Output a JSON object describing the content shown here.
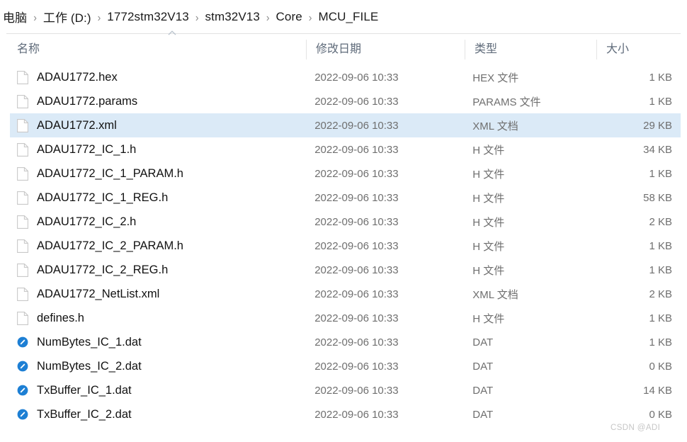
{
  "breadcrumb": {
    "separator": "›",
    "items": [
      {
        "label": "电脑"
      },
      {
        "label": "工作 (D:)"
      },
      {
        "label": "1772stm32V13"
      },
      {
        "label": "stm32V13"
      },
      {
        "label": "Core"
      },
      {
        "label": "MCU_FILE"
      }
    ]
  },
  "columns": {
    "name": "名称",
    "date": "修改日期",
    "type": "类型",
    "size": "大小",
    "sort_indicator": "ascending-caret-icon"
  },
  "colors": {
    "selection": "#dbeaf7",
    "header_text": "#5f6b7a",
    "secondary_text": "#6f6f6f",
    "dat_icon_blue": "#1d7fd4"
  },
  "files": [
    {
      "name": "ADAU1772.hex",
      "date": "2022-09-06 10:33",
      "type": "HEX 文件",
      "size": "1 KB",
      "icon": "generic-file-icon",
      "selected": false
    },
    {
      "name": "ADAU1772.params",
      "date": "2022-09-06 10:33",
      "type": "PARAMS 文件",
      "size": "1 KB",
      "icon": "generic-file-icon",
      "selected": false
    },
    {
      "name": "ADAU1772.xml",
      "date": "2022-09-06 10:33",
      "type": "XML 文档",
      "size": "29 KB",
      "icon": "generic-file-icon",
      "selected": true
    },
    {
      "name": "ADAU1772_IC_1.h",
      "date": "2022-09-06 10:33",
      "type": "H 文件",
      "size": "34 KB",
      "icon": "generic-file-icon",
      "selected": false
    },
    {
      "name": "ADAU1772_IC_1_PARAM.h",
      "date": "2022-09-06 10:33",
      "type": "H 文件",
      "size": "1 KB",
      "icon": "generic-file-icon",
      "selected": false
    },
    {
      "name": "ADAU1772_IC_1_REG.h",
      "date": "2022-09-06 10:33",
      "type": "H 文件",
      "size": "58 KB",
      "icon": "generic-file-icon",
      "selected": false
    },
    {
      "name": "ADAU1772_IC_2.h",
      "date": "2022-09-06 10:33",
      "type": "H 文件",
      "size": "2 KB",
      "icon": "generic-file-icon",
      "selected": false
    },
    {
      "name": "ADAU1772_IC_2_PARAM.h",
      "date": "2022-09-06 10:33",
      "type": "H 文件",
      "size": "1 KB",
      "icon": "generic-file-icon",
      "selected": false
    },
    {
      "name": "ADAU1772_IC_2_REG.h",
      "date": "2022-09-06 10:33",
      "type": "H 文件",
      "size": "1 KB",
      "icon": "generic-file-icon",
      "selected": false
    },
    {
      "name": "ADAU1772_NetList.xml",
      "date": "2022-09-06 10:33",
      "type": "XML 文档",
      "size": "2 KB",
      "icon": "generic-file-icon",
      "selected": false
    },
    {
      "name": "defines.h",
      "date": "2022-09-06 10:33",
      "type": "H 文件",
      "size": "1 KB",
      "icon": "generic-file-icon",
      "selected": false
    },
    {
      "name": "NumBytes_IC_1.dat",
      "date": "2022-09-06 10:33",
      "type": "DAT",
      "size": "1 KB",
      "icon": "dat-file-icon",
      "selected": false
    },
    {
      "name": "NumBytes_IC_2.dat",
      "date": "2022-09-06 10:33",
      "type": "DAT",
      "size": "0 KB",
      "icon": "dat-file-icon",
      "selected": false
    },
    {
      "name": "TxBuffer_IC_1.dat",
      "date": "2022-09-06 10:33",
      "type": "DAT",
      "size": "14 KB",
      "icon": "dat-file-icon",
      "selected": false
    },
    {
      "name": "TxBuffer_IC_2.dat",
      "date": "2022-09-06 10:33",
      "type": "DAT",
      "size": "0 KB",
      "icon": "dat-file-icon",
      "selected": false
    }
  ],
  "watermark": {
    "text": "CSDN @ADI"
  }
}
